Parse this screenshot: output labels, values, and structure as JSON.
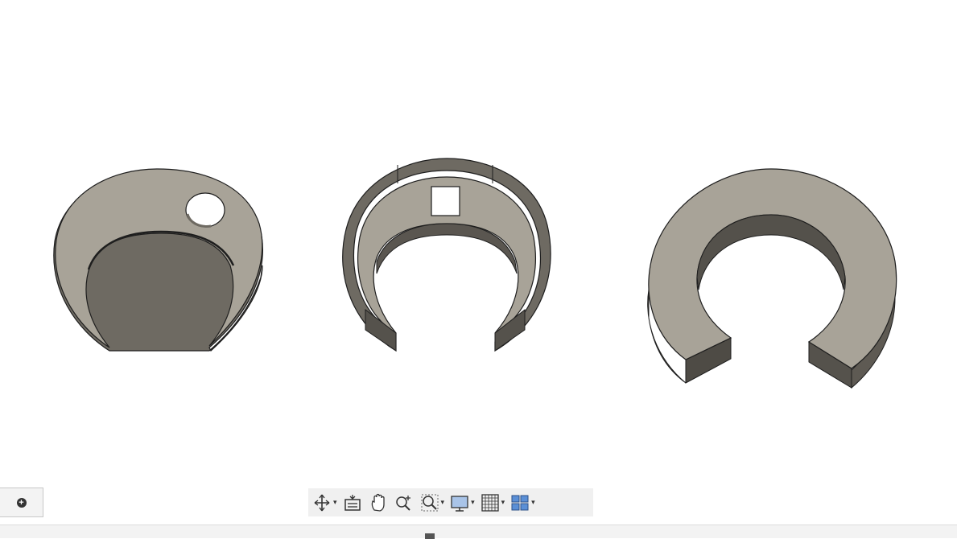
{
  "viewport": {
    "background": "#ffffff",
    "part_face_color": "#a8a398",
    "part_side_color": "#6e6a62",
    "part_edge_color": "#1e1e1e",
    "parts": [
      {
        "name": "flat-crescent-plate-with-hole"
      },
      {
        "name": "crescent-shell-with-walls"
      },
      {
        "name": "thick-c-ring"
      }
    ]
  },
  "left_panel": {
    "icon": "plus-circle-icon"
  },
  "navigation_toolbar": {
    "tools": [
      {
        "icon": "orbit-icon",
        "has_dropdown": true
      },
      {
        "icon": "look-at-icon",
        "has_dropdown": false
      },
      {
        "icon": "pan-hand-icon",
        "has_dropdown": false
      },
      {
        "icon": "zoom-icon",
        "has_dropdown": false
      },
      {
        "icon": "zoom-window-icon",
        "has_dropdown": true
      },
      {
        "icon": "display-settings-icon",
        "has_dropdown": true
      },
      {
        "icon": "grid-snaps-icon",
        "has_dropdown": true
      },
      {
        "icon": "viewports-icon",
        "has_dropdown": true
      }
    ],
    "dropdown_glyph": "▾"
  }
}
